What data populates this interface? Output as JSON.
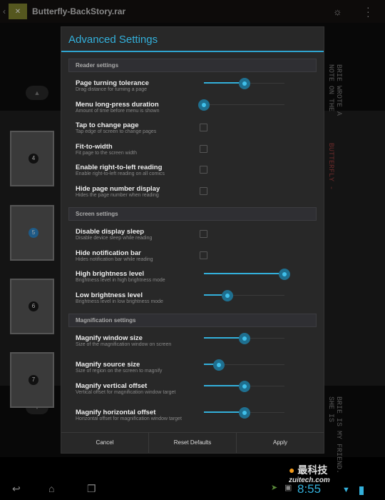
{
  "topbar": {
    "title": "Butterfly-BackStory.rar",
    "icons": [
      "back-chevron-icon",
      "app-icon",
      "brightness-icon",
      "overflow-menu-icon"
    ]
  },
  "reader": {
    "thumbnails": [
      "4",
      "5",
      "6",
      "7"
    ],
    "selected_page": "5",
    "side_text_top": "BRIE WROTE A NOTE ON THE",
    "side_text_mid": "BUTTERFLY -",
    "side_text_bottom": "BRIE IS MY FRIEND. SHE IS"
  },
  "dialog": {
    "title": "Advanced Settings",
    "accent": "#33b0db",
    "sections": [
      {
        "label": "Reader settings",
        "items": [
          {
            "title": "Page turning tolerance",
            "summary": "Drag distance for turning a page",
            "type": "slider",
            "value": 0.5
          },
          {
            "title": "Menu long-press duration",
            "summary": "Amount of time before menu is shown",
            "type": "slider",
            "value": 0.0
          },
          {
            "title": "Tap to change page",
            "summary": "Tap edge of screen to change pages",
            "type": "checkbox",
            "checked": false
          },
          {
            "title": "Fit-to-width",
            "summary": "Fit page to the screen width",
            "type": "checkbox",
            "checked": false
          },
          {
            "title": "Enable right-to-left reading",
            "summary": "Enable right-to-left reading on all comics",
            "type": "checkbox",
            "checked": false
          },
          {
            "title": "Hide page number display",
            "summary": "Hides the page number when reading",
            "type": "checkbox",
            "checked": false
          }
        ]
      },
      {
        "label": "Screen settings",
        "items": [
          {
            "title": "Disable display sleep",
            "summary": "Disable device sleep while reading",
            "type": "checkbox",
            "checked": false
          },
          {
            "title": "Hide notification bar",
            "summary": "Hides notification bar while reading",
            "type": "checkbox",
            "checked": false
          },
          {
            "title": "High brightness level",
            "summary": "Brightness level in high brightness mode",
            "type": "slider",
            "value": 1.0
          },
          {
            "title": "Low brightness level",
            "summary": "Brightness level in low brightness mode",
            "type": "slider",
            "value": 0.29
          }
        ]
      },
      {
        "label": "Magnification settings",
        "items": [
          {
            "title": "Magnify window size",
            "summary": "Size of the magnification window on screen",
            "type": "slider",
            "value": 0.5,
            "tall": true
          },
          {
            "title": "Magnify source size",
            "summary": "Size of region on the screen to magnify",
            "type": "slider",
            "value": 0.19
          },
          {
            "title": "Magnify vertical offset",
            "summary": "Vertical offset for magnification window target",
            "type": "slider",
            "value": 0.5,
            "tall": true
          },
          {
            "title": "Magnify horizontal offset",
            "summary": "Horizontal offset for magnification window target",
            "type": "slider",
            "value": 0.5,
            "tall": true
          }
        ]
      }
    ],
    "buttons": {
      "cancel": "Cancel",
      "reset": "Reset Defaults",
      "apply": "Apply"
    }
  },
  "statusbar": {
    "time": "8:55",
    "icons": [
      "back-icon",
      "home-icon",
      "recent-apps-icon",
      "notification-icon",
      "image-icon",
      "wifi-icon",
      "battery-icon"
    ]
  },
  "watermark": {
    "cn": "最科技",
    "url": "zuitech.com"
  }
}
